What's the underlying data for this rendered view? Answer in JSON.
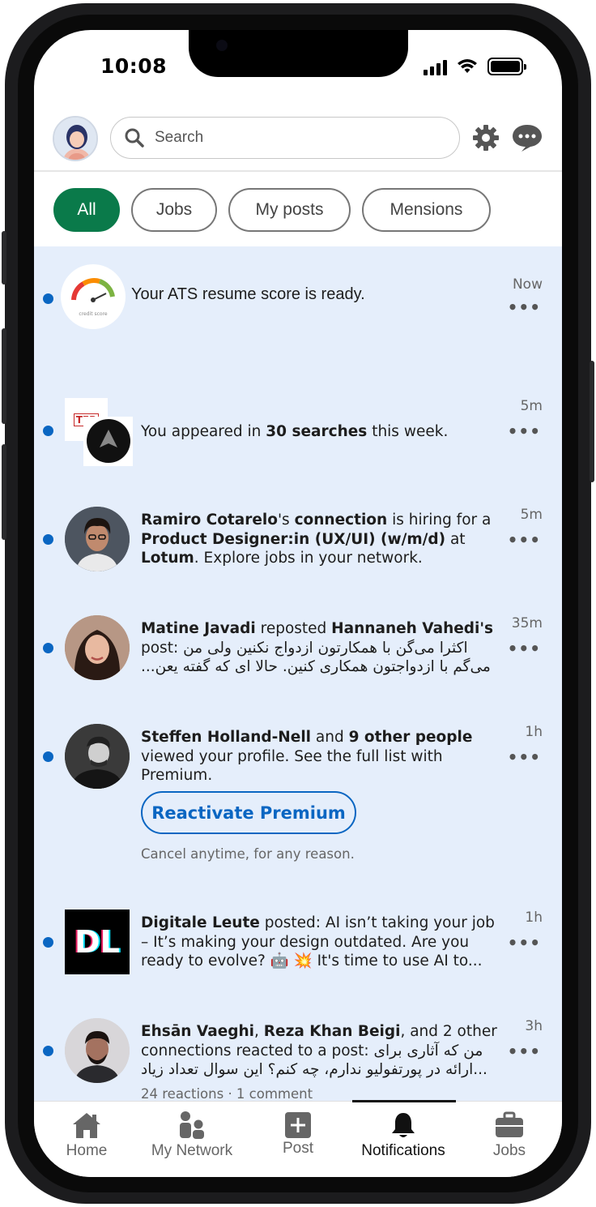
{
  "status_bar": {
    "time": "10:08"
  },
  "header": {
    "search_placeholder": "Search"
  },
  "filters": [
    {
      "label": "All",
      "active": true
    },
    {
      "label": "Jobs",
      "active": false
    },
    {
      "label": "My posts",
      "active": false
    },
    {
      "label": "Mensions",
      "active": false
    }
  ],
  "notifications": [
    {
      "text": "Your ATS resume score is ready.",
      "time": "Now",
      "logo_caption": "credit score"
    },
    {
      "text_pre": "You appeared in ",
      "text_bold": "30 searches",
      "text_post": " this week.",
      "time": "5m",
      "logo_text": "TER"
    },
    {
      "name": "Ramiro Cotarelo",
      "s1": "'s ",
      "connection": "connection",
      "s2": " is hiring for a ",
      "role": "Product Designer:in (UX/UI) (w/m/d)",
      "s3": " at ",
      "company": "Lotum",
      "s4": ". Explore jobs in your network.",
      "time": "5m"
    },
    {
      "name": "Matine Javadi",
      "s1": " reposted ",
      "name2": "Hannaneh Vahedi's",
      "line2": "post: اکثرا می‌گن با همکارتون ازدواج نکنین ولی من",
      "line3": "می‌گم با ازدواجتون همکاری کنین. حالا ای که گفته یعن...",
      "time": "35m"
    },
    {
      "name": "Steffen Holland-Nell",
      "s1": " and ",
      "others": "9 other people",
      "s2": " viewed your profile. See the full list with Premium.",
      "cta": "Reactivate Premium",
      "cta_note": "Cancel anytime, for any reason.",
      "time": "1h"
    },
    {
      "name": "Digitale Leute",
      "s1": " posted: AI isn’t taking your job – It’s making your design outdated. Are you ready to evolve? 🤖 💥 It's time to use AI to...",
      "logo_text": "DL",
      "time": "1h"
    },
    {
      "name": "Ehsān Vaeghi",
      "s1": ", ",
      "name2": "Reza Khan Beigi",
      "s2": ", and 2 other",
      "line2": "connections reacted to a post: من که آثاری برای",
      "line3": "ارائه در پورتفولیو ندارم، چه کنم؟ این سوال تعداد زیاد...",
      "meta": "24 reactions · 1 comment",
      "time": "3h"
    }
  ],
  "bottom_nav": [
    {
      "label": "Home",
      "icon": "home-icon"
    },
    {
      "label": "My Network",
      "icon": "network-icon"
    },
    {
      "label": "Post",
      "icon": "post-icon"
    },
    {
      "label": "Notifications",
      "icon": "bell-icon",
      "active": true
    },
    {
      "label": "Jobs",
      "icon": "briefcase-icon"
    }
  ],
  "colors": {
    "accent_green": "#0a7a4a",
    "link_blue": "#0a66c2",
    "unread_bg": "#e5eefb"
  }
}
